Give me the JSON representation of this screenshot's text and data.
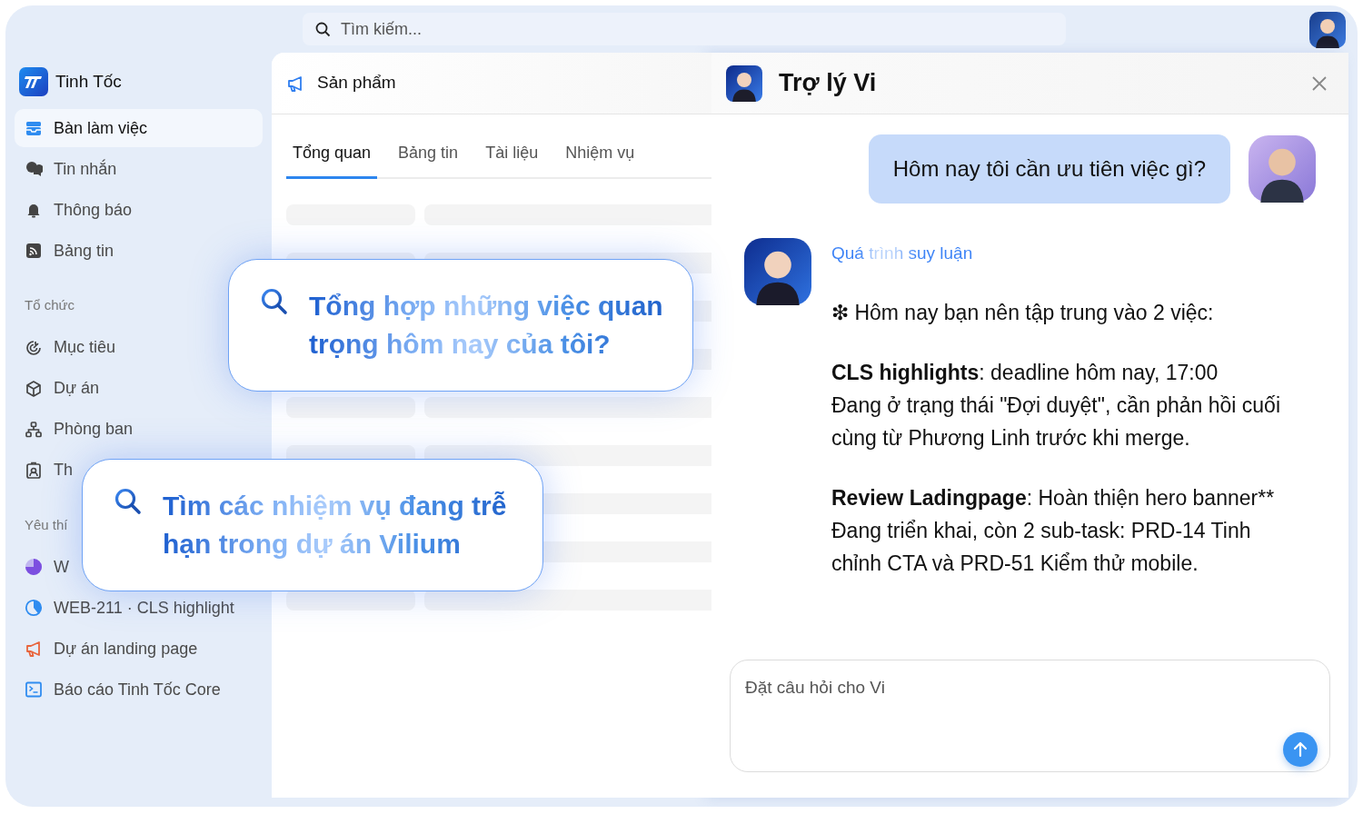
{
  "search": {
    "placeholder": "Tìm kiếm..."
  },
  "sidebar": {
    "brand": "Tinh Tốc",
    "nav": [
      {
        "label": "Bàn làm việc",
        "kind": "desk",
        "selected": true
      },
      {
        "label": "Tin nhắn",
        "kind": "chat",
        "selected": false
      },
      {
        "label": "Thông báo",
        "kind": "bell",
        "selected": false
      },
      {
        "label": "Bảng tin",
        "kind": "feed",
        "selected": false
      }
    ],
    "sections": [
      {
        "heading": "Tổ chức",
        "items": [
          {
            "label": "Mục tiêu",
            "kind": "target",
            "selected": false
          },
          {
            "label": "Dự án",
            "kind": "cube",
            "selected": false
          },
          {
            "label": "Phòng ban",
            "kind": "org",
            "selected": false
          },
          {
            "label": "Th",
            "kind": "badge",
            "selected": false
          }
        ]
      },
      {
        "heading": "Yêu thí",
        "items": [
          {
            "label": "W",
            "kind": "pie",
            "color": "#7c4fe0",
            "selected": false
          },
          {
            "label": "WEB-211 · CLS highlight",
            "kind": "pie2",
            "color": "#2f8cf0",
            "selected": false
          },
          {
            "label": "Dự án landing page",
            "kind": "megaphone",
            "color": "#e8643c",
            "selected": false
          },
          {
            "label": "Báo cáo Tinh Tốc Core",
            "kind": "terminal",
            "color": "#2f8cf0",
            "selected": false
          }
        ]
      }
    ]
  },
  "main": {
    "title": "Sản phẩm",
    "tabs": [
      {
        "label": "Tổng quan",
        "selected": true
      },
      {
        "label": "Bảng tin",
        "selected": false
      },
      {
        "label": "Tài liệu",
        "selected": false
      },
      {
        "label": "Nhiệm vụ",
        "selected": false
      }
    ]
  },
  "suggestions": [
    {
      "text": "Tổng hợp những việc quan trọng hôm nay của tôi?"
    },
    {
      "text": "Tìm các nhiệm vụ đang trễ hạn trong dự án Vilium"
    }
  ],
  "chat": {
    "title": "Trợ lý Vi",
    "user_message": "Hôm nay tôi cần ưu tiên việc gì?",
    "reasoning_label": "Quá trình suy luận",
    "reply": [
      {
        "text": "❇ Hôm nay bạn nên tập trung vào 2 việc:"
      },
      {
        "lead": "CLS highlights",
        "text": ": deadline hôm nay, 17:00\nĐang ở trạng thái \"Đợi duyệt\", cần phản hồi cuối cùng từ Phương Linh trước khi merge."
      },
      {
        "lead": "Review Ladingpage",
        "text": ": Hoàn thiện hero banner** Đang triển khai, còn 2 sub-task: PRD-14 Tinh chỉnh CTA và PRD-51 Kiểm thử mobile."
      }
    ],
    "input": {
      "placeholder": "Đặt câu hỏi cho Vi"
    }
  }
}
